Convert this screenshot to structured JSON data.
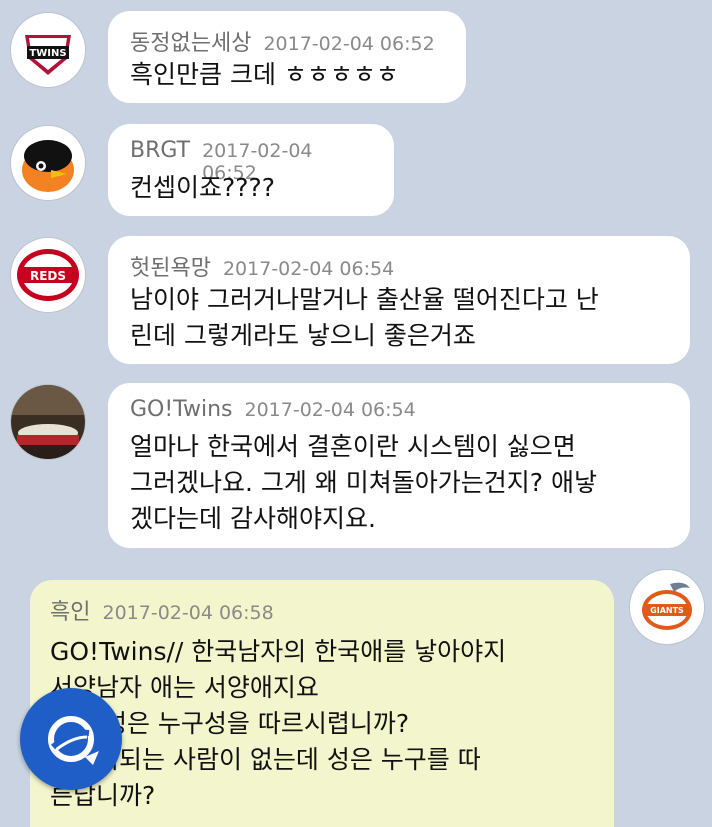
{
  "messages": [
    {
      "nickname": "동정없는세상",
      "time": "2017-02-04 06:52",
      "text": "흑인만큼 크데 ㅎㅎㅎㅎㅎ"
    },
    {
      "nickname": "BRGT",
      "time": "2017-02-04 06:52",
      "text": "컨셉이죠????"
    },
    {
      "nickname": "헛된욕망",
      "time": "2017-02-04 06:54",
      "text": "남이야 그러거나말거나 출산율 떨어진다고 난\n린데 그렇게라도 낳으니 좋은거죠"
    },
    {
      "nickname": "GO!Twins",
      "time": "2017-02-04 06:54",
      "text": "얼마나 한국에서 결혼이란 시스템이 싫으면\n그러겠나요. 그게 왜 미쳐돌아가는건지? 애낳\n겠다는데 감사해야지요."
    },
    {
      "nickname": "흑인",
      "time": "2017-02-04 06:58",
      "text": "GO!Twins// 한국남자의 한국애를 낳아야지\n서양남자 애는 서양애지요\n그럼 성은 누구성을 따르시렵니까?\n아버지되는 사람이 없는데 성은 누구를 따\n른답니까?"
    }
  ],
  "avatars": {
    "twins_text": "TWINS",
    "reds_text": "REDS",
    "giants_text": "GIANTS"
  },
  "colors": {
    "background": "#c9d3e1",
    "bubble_other": "#ffffff",
    "bubble_mine": "#f3f6cc",
    "fab": "#1f5ec6"
  }
}
